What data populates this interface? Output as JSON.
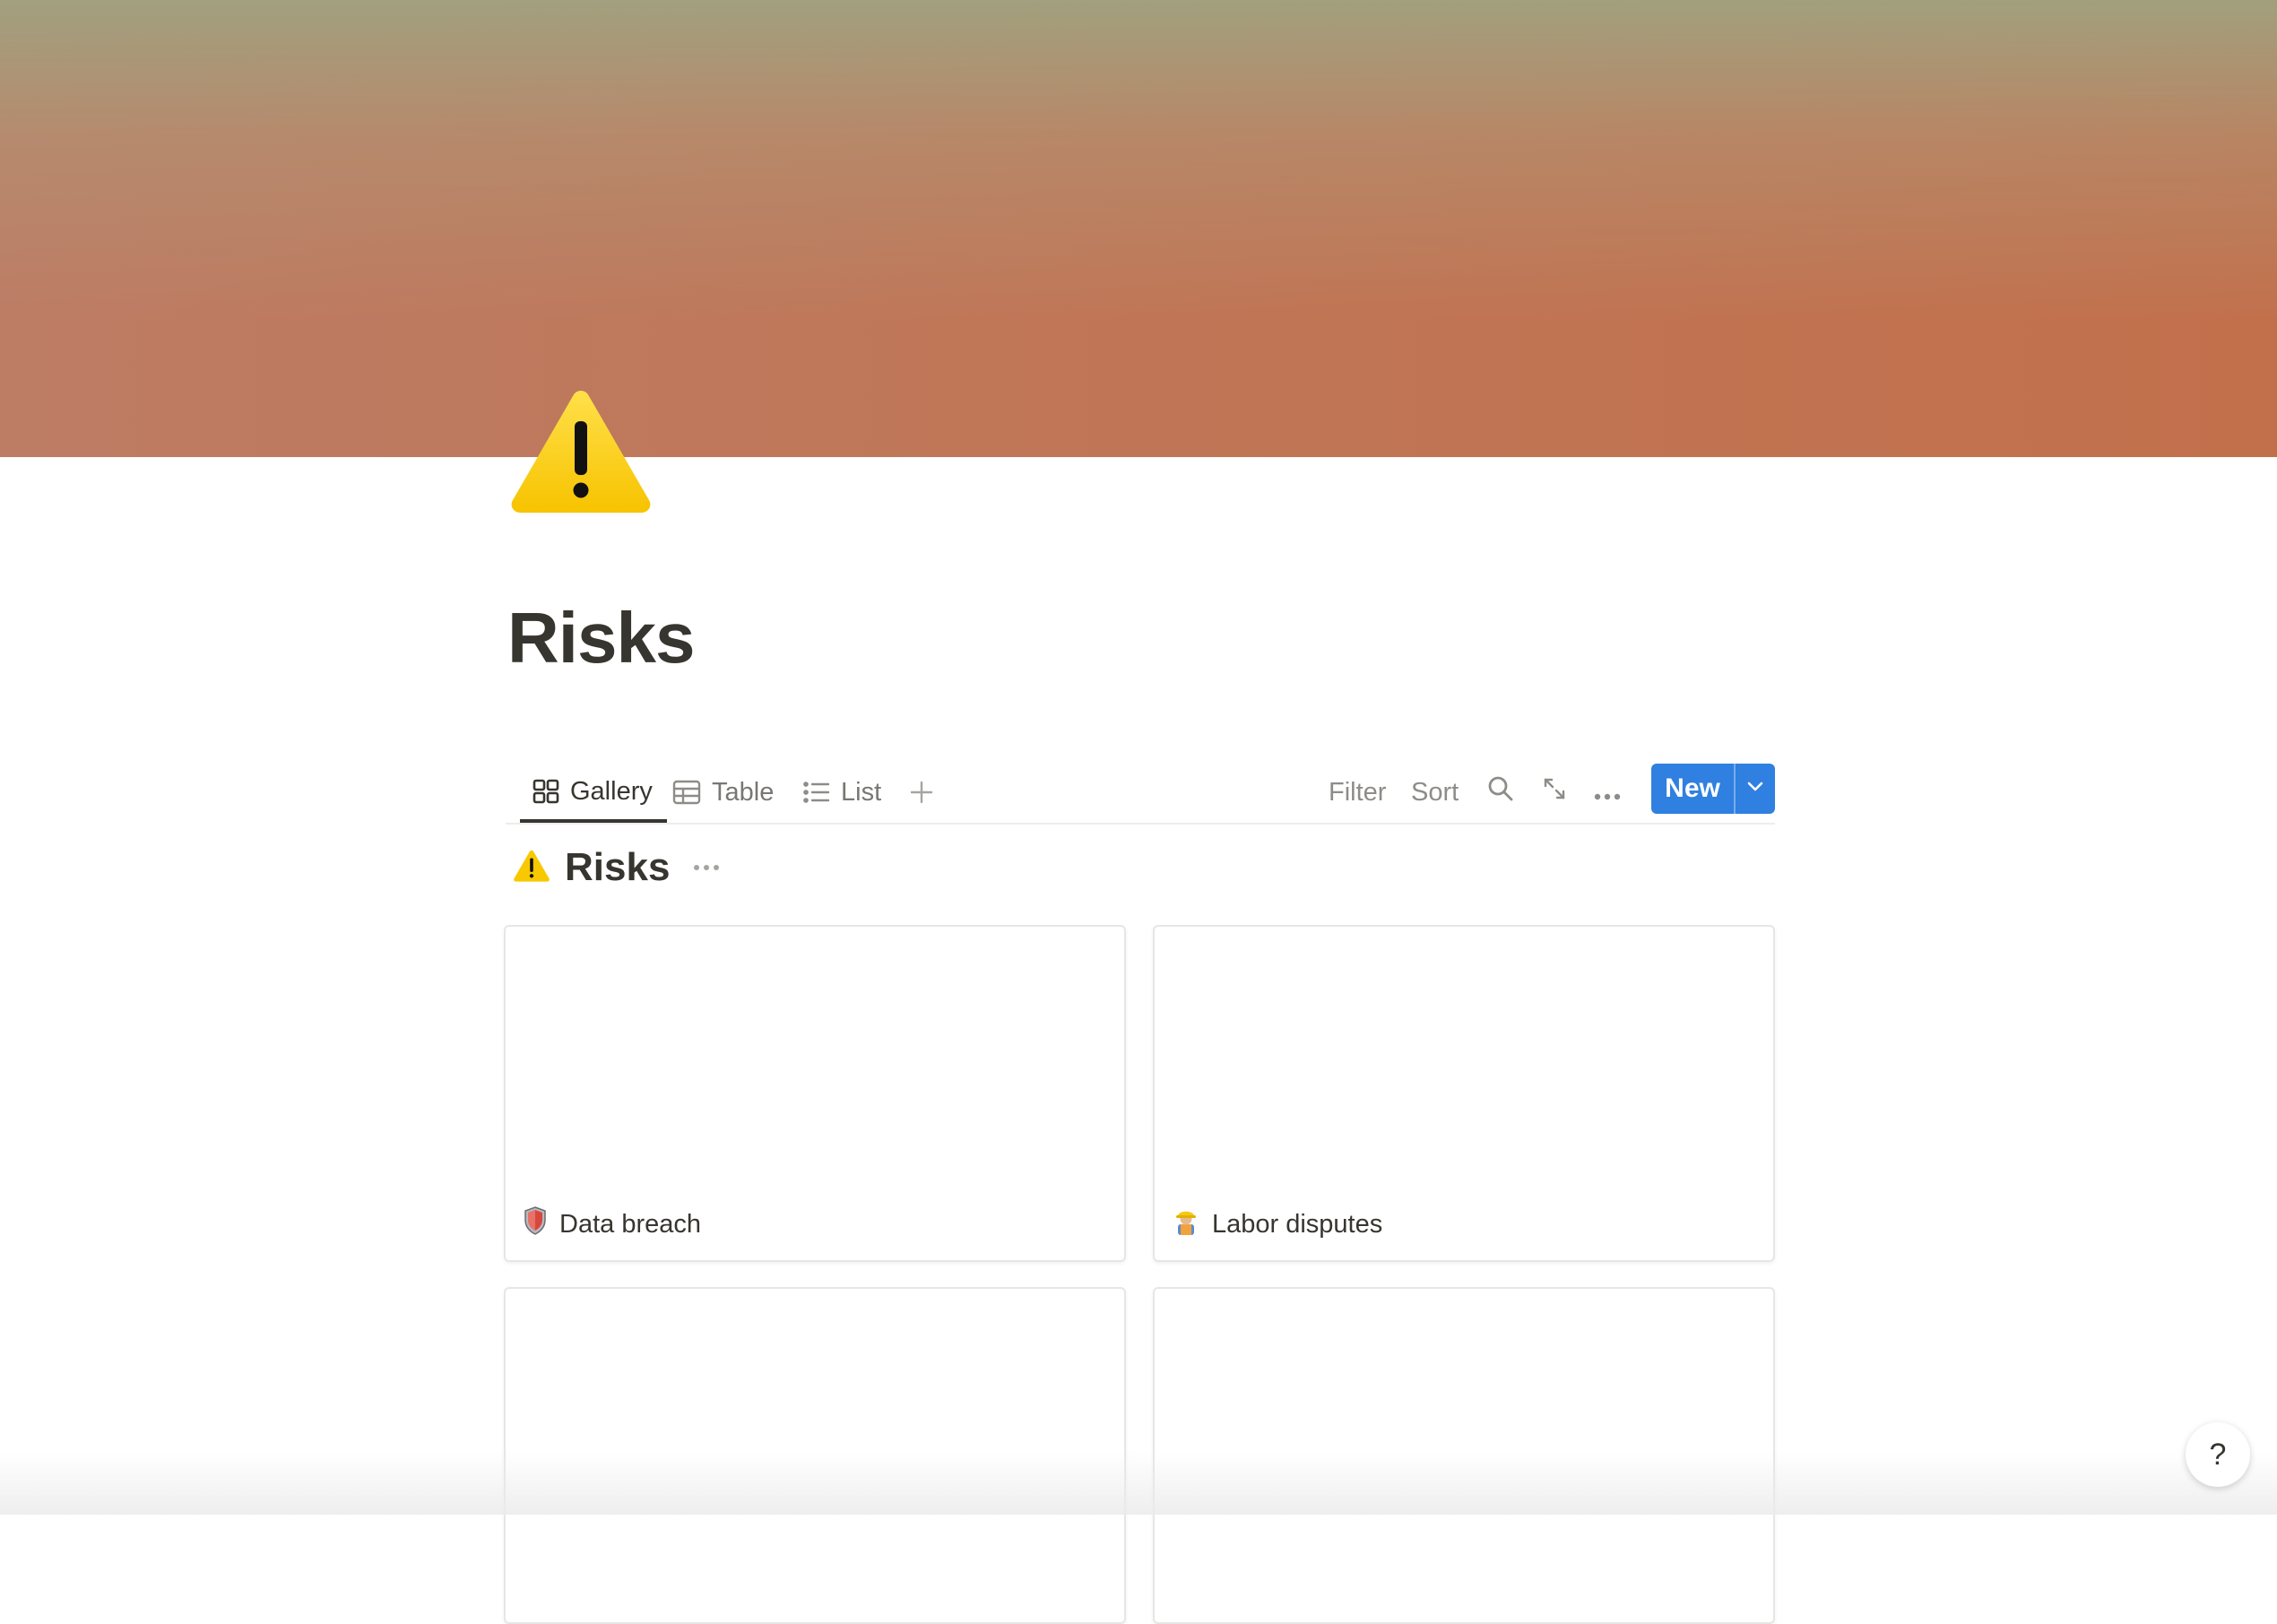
{
  "page": {
    "title": "Risks"
  },
  "views": {
    "tabs": [
      {
        "label": "Gallery",
        "icon": "gallery-icon",
        "active": true
      },
      {
        "label": "Table",
        "icon": "table-icon",
        "active": false
      },
      {
        "label": "List",
        "icon": "list-icon",
        "active": false
      }
    ],
    "add_view_icon": "plus-icon"
  },
  "toolbar": {
    "filter_label": "Filter",
    "sort_label": "Sort",
    "search_icon": "search-icon",
    "expand_icon": "expand-icon",
    "more_icon": "more-icon",
    "new_label": "New",
    "new_caret_icon": "chevron-down-icon"
  },
  "database": {
    "title": "Risks",
    "icon": "warning-icon",
    "more_icon": "more-icon"
  },
  "cards": [
    {
      "title": "Data breach",
      "icon": "shield-icon"
    },
    {
      "title": "Labor disputes",
      "icon": "construction-worker-icon"
    },
    {
      "title": "",
      "icon": ""
    },
    {
      "title": "",
      "icon": ""
    }
  ],
  "help": {
    "label": "?"
  },
  "colors": {
    "accent": "#2f80e1",
    "text": "#37352f",
    "muted": "#787774"
  }
}
